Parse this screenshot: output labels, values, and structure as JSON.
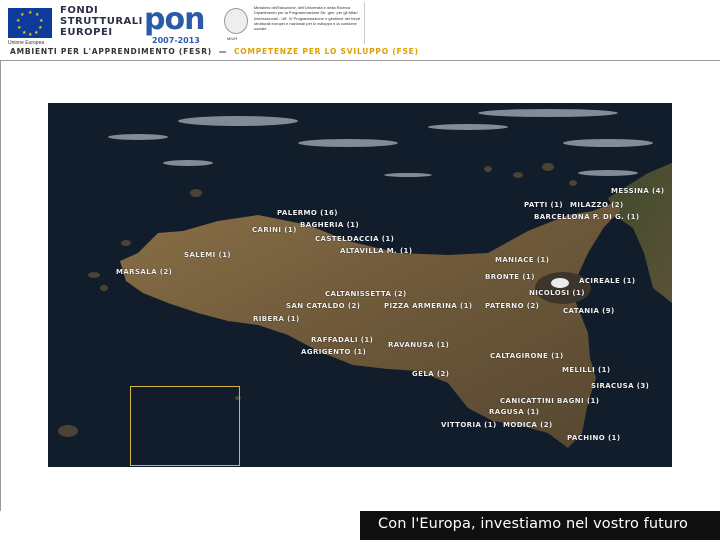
{
  "header": {
    "eu_caption": "Unione Europea",
    "fondi_lines": [
      "FONDI",
      "STRUTTURALI",
      "EUROPEI"
    ],
    "pon_text": "pon",
    "pon_years": "2007-2013",
    "ministry_text": "Ministero dell'Istruzione, dell'Università e della Ricerca Dipartimento per la Programmazione Dir. gen. per gli Affari Internazionali - Uff. IV Programmazione e gestione dei fondi strutturali europei e nazionali per lo sviluppo e la coesione sociale",
    "ministry_caption": "MIUR",
    "tagline_left": "AMBIENTI PER L'APPRENDIMENTO (FESR)",
    "tagline_dash": "—",
    "tagline_right": "COMPETENZE PER LO SVILUPPO (FSE)"
  },
  "map_labels": [
    {
      "id": "messina",
      "text": "MESSINA (4)"
    },
    {
      "id": "patti",
      "text": "PATTI (1)"
    },
    {
      "id": "milazzo",
      "text": "MILAZZO (2)"
    },
    {
      "id": "barcellona",
      "text": "BARCELLONA P. DI G. (1)"
    },
    {
      "id": "palermo",
      "text": "PALERMO (16)"
    },
    {
      "id": "bagheria",
      "text": "BAGHERIA (1)"
    },
    {
      "id": "carini",
      "text": "CARINI (1)"
    },
    {
      "id": "casteldaccia",
      "text": "CASTELDACCIA (1)"
    },
    {
      "id": "altavilla",
      "text": "ALTAVILLA M. (1)"
    },
    {
      "id": "salemi",
      "text": "SALEMI (1)"
    },
    {
      "id": "maniace",
      "text": "MANIACE (1)"
    },
    {
      "id": "marsala",
      "text": "MARSALA (2)"
    },
    {
      "id": "bronte",
      "text": "BRONTE (1)"
    },
    {
      "id": "acireale",
      "text": "ACIREALE (1)"
    },
    {
      "id": "nicolosi",
      "text": "NICOLOSI (1)"
    },
    {
      "id": "caltanissetta",
      "text": "CALTANISSETTA (2)"
    },
    {
      "id": "sancataldo",
      "text": "SAN CATALDO (2)"
    },
    {
      "id": "piazza",
      "text": "PIZZA ARMERINA (1)"
    },
    {
      "id": "paterno",
      "text": "PATERNO (2)"
    },
    {
      "id": "catania",
      "text": "CATANIA (9)"
    },
    {
      "id": "ribera",
      "text": "RIBERA (1)"
    },
    {
      "id": "raffadali",
      "text": "RAFFADALI (1)"
    },
    {
      "id": "agrigento",
      "text": "AGRIGENTO (1)"
    },
    {
      "id": "ravanusa",
      "text": "RAVANUSA (1)"
    },
    {
      "id": "caltagirone",
      "text": "CALTAGIRONE (1)"
    },
    {
      "id": "melilli",
      "text": "MELILLI (1)"
    },
    {
      "id": "gela",
      "text": "GELA (2)"
    },
    {
      "id": "siracusa",
      "text": "SIRACUSA (3)"
    },
    {
      "id": "canicattini",
      "text": "CANICATTINI BAGNI (1)"
    },
    {
      "id": "ragusa",
      "text": "RAGUSA (1)"
    },
    {
      "id": "vittoria",
      "text": "VITTORIA (1)"
    },
    {
      "id": "modica",
      "text": "MODICA (2)"
    },
    {
      "id": "pachino",
      "text": "PACHINO (1)"
    }
  ],
  "footer": {
    "slogan": "Con l'Europa, investiamo nel vostro futuro"
  }
}
